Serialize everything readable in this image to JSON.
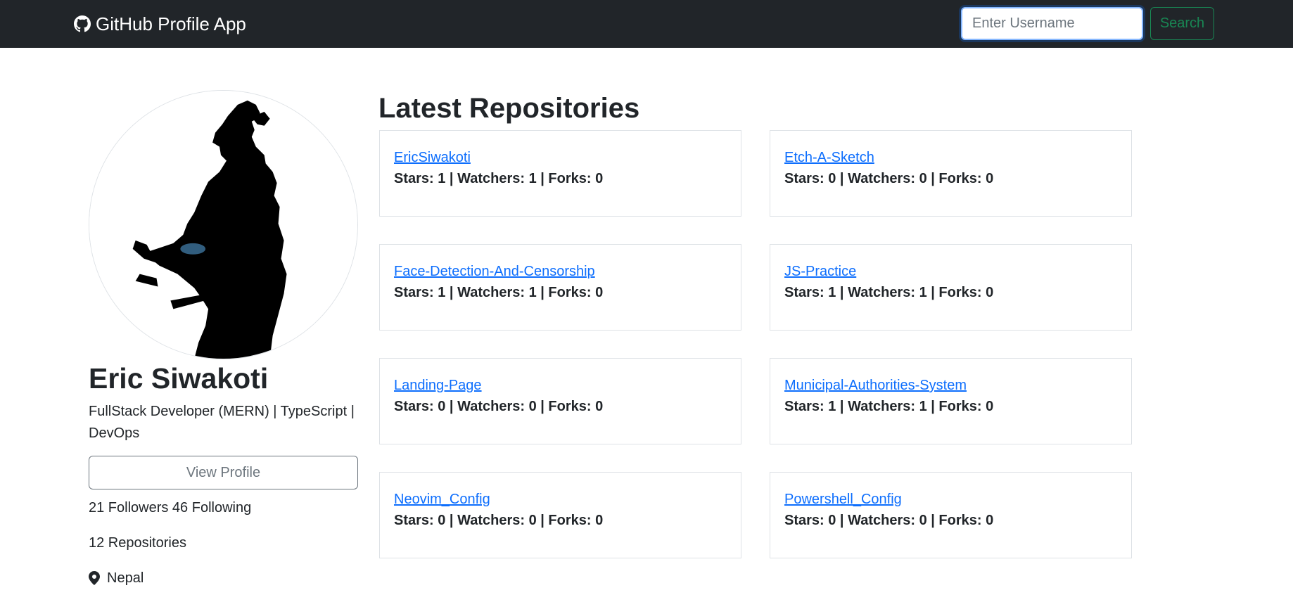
{
  "navbar": {
    "brand_label": "GitHub Profile App",
    "brand_icon": "github-icon",
    "search_placeholder": "Enter Username",
    "search_value": "",
    "search_button_label": "Search"
  },
  "profile": {
    "name": "Eric Siwakoti",
    "bio": "FullStack Developer (MERN) | TypeScript | DevOps",
    "view_profile_label": "View Profile",
    "followers_following": "21 Followers 46 Following",
    "repositories": "12 Repositories",
    "location_icon": "map-pin-icon",
    "location": "Nepal"
  },
  "repos_section": {
    "title": "Latest Repositories",
    "repos": [
      {
        "name": "EricSiwakoti",
        "stats": "Stars: 1 | Watchers: 1 | Forks: 0"
      },
      {
        "name": "Etch-A-Sketch",
        "stats": "Stars: 0 | Watchers: 0 | Forks: 0"
      },
      {
        "name": "Face-Detection-And-Censorship",
        "stats": "Stars: 1 | Watchers: 1 | Forks: 0"
      },
      {
        "name": "JS-Practice",
        "stats": "Stars: 1 | Watchers: 1 | Forks: 0"
      },
      {
        "name": "Landing-Page",
        "stats": "Stars: 0 | Watchers: 0 | Forks: 0"
      },
      {
        "name": "Municipal-Authorities-System",
        "stats": "Stars: 1 | Watchers: 1 | Forks: 0"
      },
      {
        "name": "Neovim_Config",
        "stats": "Stars: 0 | Watchers: 0 | Forks: 0"
      },
      {
        "name": "Powershell_Config",
        "stats": "Stars: 0 | Watchers: 0 | Forks: 0"
      }
    ]
  },
  "colors": {
    "navbar_bg": "#212529",
    "link": "#0d6efd",
    "search_button": "#198754",
    "secondary": "#6c757d"
  }
}
